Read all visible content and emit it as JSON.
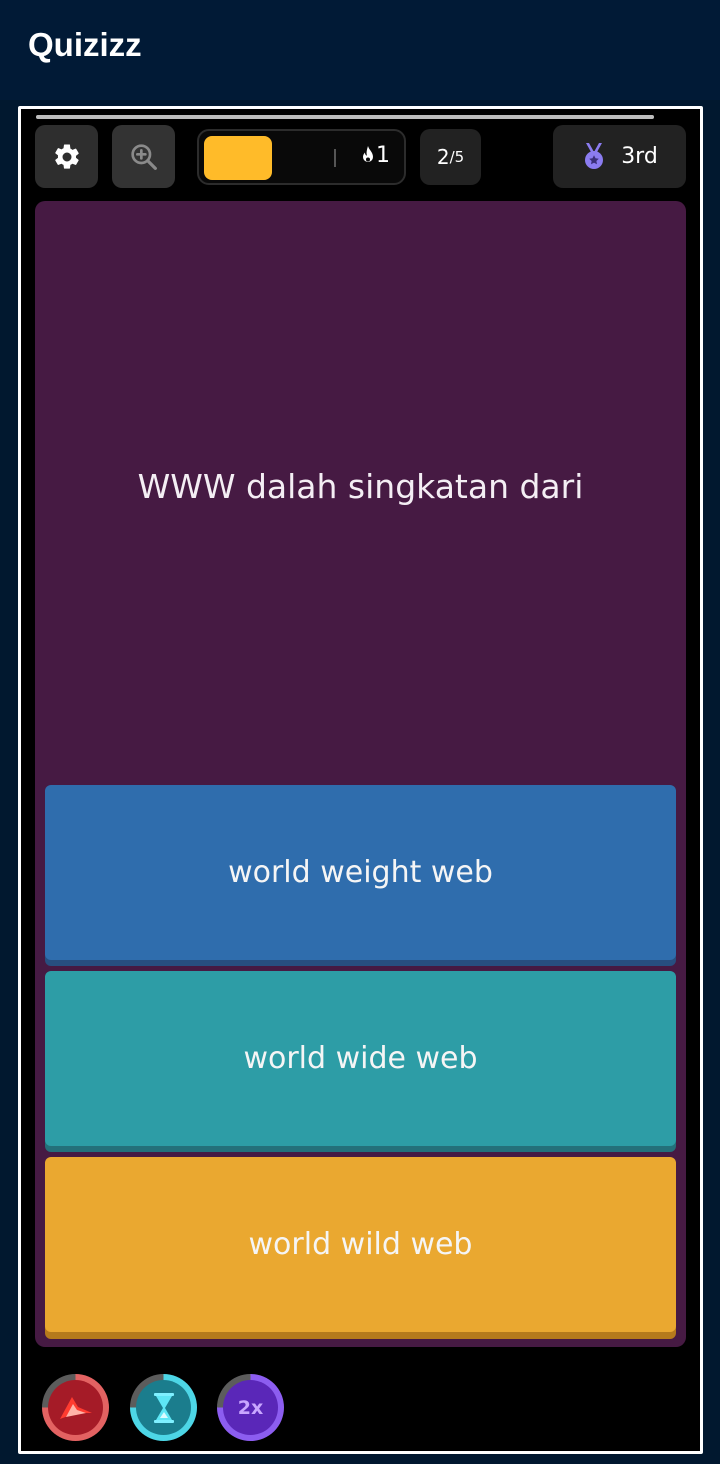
{
  "app": {
    "title": "Quizizz"
  },
  "timer": {
    "fraction_remaining": 1.0
  },
  "progress": {
    "fraction": 0.35,
    "streak_count": "1"
  },
  "question_counter": {
    "current": "2",
    "total": "/5"
  },
  "rank": {
    "label": "3rd"
  },
  "question": {
    "text": "WWW dalah singkatan dari"
  },
  "options": [
    {
      "text": "world weight web",
      "color": "#2f6dad"
    },
    {
      "text": "world wide web",
      "color": "#2d9da6"
    },
    {
      "text": "world wild web",
      "color": "#eaa830"
    }
  ],
  "powerups": [
    {
      "icon": "streak-booster-icon",
      "color": "#e36262"
    },
    {
      "icon": "hourglass-icon",
      "color": "#4dd6e6"
    },
    {
      "icon": "double-points-icon",
      "label": "2x",
      "color": "#8c5df0"
    }
  ],
  "colors": {
    "background": "#01182f",
    "question_card": "#461a43",
    "progress_fill": "#ffbb29",
    "rank_medal": "#8b7cf0"
  }
}
